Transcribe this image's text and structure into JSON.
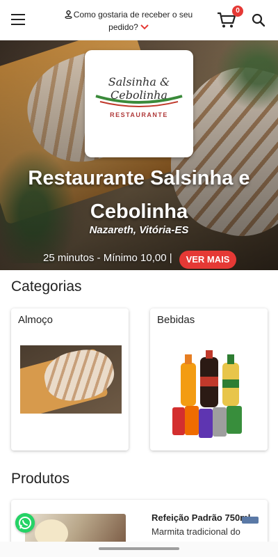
{
  "header": {
    "delivery_prompt": "Como gostaria de receber o seu pedido?",
    "cart_count": "0",
    "icons": [
      "menu-icon",
      "location-pin-icon",
      "chevron-down-icon",
      "cart-icon",
      "search-icon"
    ]
  },
  "restaurant": {
    "logo_script": "Salsinha & Cebolinha",
    "logo_subtitle": "RESTAURANTE",
    "name": "Restaurante Salsinha e Cebolinha",
    "location": "Nazareth, Vitória-ES",
    "info": "25 minutos - Mínimo 10,00 |",
    "ver_mais_label": "VER MAIS"
  },
  "categories": {
    "title": "Categorias",
    "items": [
      {
        "label": "Almoço"
      },
      {
        "label": "Bebidas"
      }
    ]
  },
  "products": {
    "title": "Produtos",
    "items": [
      {
        "name": "Refeição Padrão 750ml",
        "description": "Marmita tradicional do"
      }
    ]
  },
  "colors": {
    "accent": "#e53935",
    "whatsapp": "#25d366"
  }
}
